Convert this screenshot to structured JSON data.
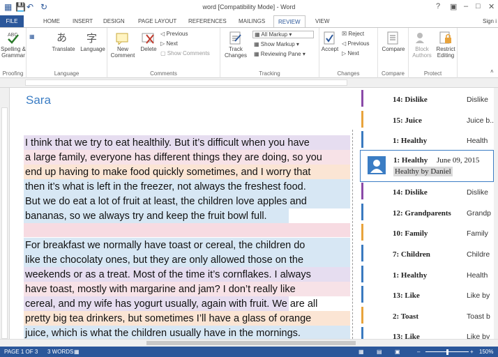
{
  "titlebar": {
    "title": "word [Compatibility Mode] - Word",
    "help": "?"
  },
  "tabs": [
    "FILE",
    "HOME",
    "INSERT",
    "DESIGN",
    "PAGE LAYOUT",
    "REFERENCES",
    "MAILINGS",
    "REVIEW",
    "VIEW"
  ],
  "signin": "Sign i",
  "ribbon": {
    "proofing": {
      "label": "Proofing",
      "spelling": "Spelling &",
      "grammar": "Grammar"
    },
    "language": {
      "label": "Language",
      "translate": "Translate",
      "language": "Language"
    },
    "comments": {
      "label": "Comments",
      "new1": "New",
      "new2": "Comment",
      "delete": "Delete",
      "previous": "Previous",
      "next": "Next",
      "show": "Show Comments"
    },
    "tracking": {
      "label": "Tracking",
      "track1": "Track",
      "track2": "Changes",
      "markup": "All Markup",
      "showmarkup": "Show Markup",
      "pane": "Reviewing Pane"
    },
    "changes": {
      "label": "Changes",
      "accept": "Accept",
      "reject": "Reject",
      "previous": "Previous",
      "next": "Next"
    },
    "compare": {
      "label": "Compare",
      "compare": "Compare"
    },
    "protect": {
      "label": "Protect",
      "block1": "Block",
      "block2": "Authors",
      "restrict1": "Restrict",
      "restrict2": "Editing"
    }
  },
  "document": {
    "title": "Sara",
    "lines": [
      "I think that we try to eat healthily. But it’s difficult when you have",
      "a large family, everyone has different things they are doing, so you",
      "end up having to make food quickly sometimes, and I worry that",
      "then it’s what is left in the freezer, not always the freshest food.",
      "But we do eat a lot of fruit at least, the children love apples and",
      "bananas, so we always try and keep the fruit bowl full.",
      "",
      "For breakfast we normally have toast or cereal, the children do",
      "like the chocolaty ones, but they are only allowed those on the",
      "weekends or as a treat. Most of the time it’s cornflakes. I always",
      "have toast, mostly with margarine and jam? I don’t really like",
      "cereal, and my wife has yogurt usually, again with fruit. We are all",
      "pretty big tea drinkers, but sometimes I’ll have a glass of orange",
      "juice, which is what the children usually have in the mornings."
    ]
  },
  "comments": [
    {
      "k": "14: Dislike",
      "v": "Dislike",
      "color": "#8a4aa8"
    },
    {
      "k": "15: Juice",
      "v": "Juice b...",
      "color": "#e8a33c"
    },
    {
      "k": "1: Healthy",
      "v": "Health",
      "color": "#3a7ac0"
    },
    {
      "k": "14: Dislike",
      "v": "Dislike",
      "color": "#8a4aa8"
    },
    {
      "k": "12: Grandparents",
      "v": "Grandp",
      "color": "#3a7ac0"
    },
    {
      "k": "10: Family",
      "v": "Family",
      "color": "#e8a33c"
    },
    {
      "k": "7: Children",
      "v": "Childre",
      "color": "#3a7ac0"
    },
    {
      "k": "1: Healthy",
      "v": "Health",
      "color": "#3a7ac0"
    },
    {
      "k": "13: Like",
      "v": "Like by",
      "color": "#3a7ac0"
    },
    {
      "k": "2: Toast",
      "v": "Toast b",
      "color": "#e8a33c"
    },
    {
      "k": "13: Like",
      "v": "Like by",
      "color": "#3a7ac0"
    }
  ],
  "active_comment": {
    "k": "1: Healthy",
    "date": "June 09, 2015",
    "text": "Healthy by Daniel"
  },
  "status": {
    "page": "PAGE 1 OF 3",
    "words": "3 WORDS",
    "zoom": "150%"
  }
}
